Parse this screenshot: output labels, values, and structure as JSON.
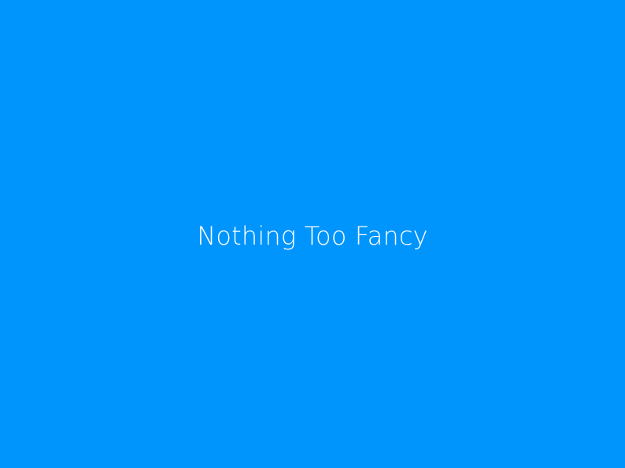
{
  "slide": {
    "title": "Nothing Too Fancy"
  },
  "colors": {
    "background": "#0095fc",
    "text": "#ffffff"
  }
}
